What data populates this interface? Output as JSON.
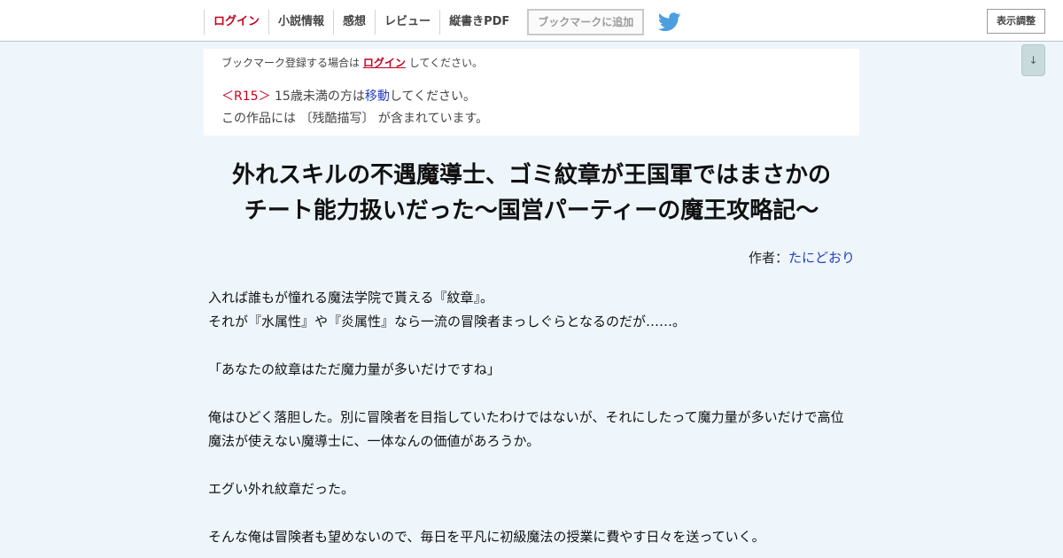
{
  "nav": {
    "items": [
      "ログイン",
      "小説情報",
      "感想",
      "レビュー",
      "縦書きPDF"
    ],
    "bookmark": "ブックマークに追加",
    "display_settings": "表示調整",
    "scroll_down": "↓"
  },
  "notice": {
    "line1_pre": "ブックマーク登録する場合は",
    "line1_link": "ログイン",
    "line1_post": "してください。",
    "r15": "＜R15＞",
    "line2_pre": "15歳未満の方は",
    "line2_link": "移動",
    "line2_post": "してください。",
    "line3": "この作品には 〔残酷描写〕 が含まれています。"
  },
  "novel": {
    "title_line1": "外れスキルの不遇魔導士、ゴミ紋章が王国軍ではまさかの",
    "title_line2": "チート能力扱いだった〜国営パーティーの魔王攻略記〜",
    "author_label": "作者：",
    "author_name": "たにどおり",
    "summary": [
      "入れば誰もが憧れる魔法学院で貰える『紋章』。",
      "それが『水属性』や『炎属性』なら一流の冒険者まっしぐらとなるのだが……。",
      "",
      "「あなたの紋章はただ魔力量が多いだけですね」",
      "",
      "俺はひどく落胆した。別に冒険者を目指していたわけではないが、それにしたって魔力量が多いだけで高位",
      "魔法が使えない魔導士に、一体なんの価値があろうか。",
      "",
      "エグい外れ紋章だった。",
      "",
      "そんな俺は冒険者も望めないので、毎日を平凡に初級魔法の授業に費やす日々を送っていく。"
    ]
  },
  "colors": {
    "background": "#eef6fc",
    "accent_red": "#c8001e",
    "link_blue": "#2540c0",
    "twitter_blue": "#4b9fe0"
  }
}
